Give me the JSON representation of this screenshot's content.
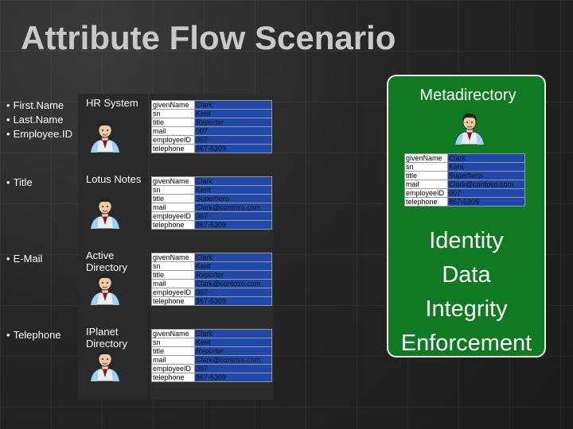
{
  "slide": {
    "title": "Attribute Flow Scenario"
  },
  "rows": [
    {
      "attributes": [
        "First.Name",
        "Last.Name",
        "Employee.ID"
      ],
      "system_name": "HR System",
      "records": [
        [
          "givenName",
          "Clark"
        ],
        [
          "sn",
          "Kent"
        ],
        [
          "title",
          "Reporter"
        ],
        [
          "mail",
          "007"
        ],
        [
          "employeeID",
          "007"
        ],
        [
          "telephone",
          "867-5309"
        ]
      ]
    },
    {
      "attributes": [
        "Title"
      ],
      "system_name": "Lotus Notes",
      "records": [
        [
          "givenName",
          "Clark"
        ],
        [
          "sn",
          "Kent"
        ],
        [
          "title",
          "Superhero"
        ],
        [
          "mail",
          "Clark@contoso.com"
        ],
        [
          "employeeID",
          "007"
        ],
        [
          "telephone",
          "867-5309"
        ]
      ]
    },
    {
      "attributes": [
        "E-Mail"
      ],
      "system_name": "Active Directory",
      "records": [
        [
          "givenName",
          "Clark"
        ],
        [
          "sn",
          "Kent"
        ],
        [
          "title",
          "Reporter"
        ],
        [
          "mail",
          "Clark@contoso.com"
        ],
        [
          "employeeID",
          "007"
        ],
        [
          "telephone",
          "867-5309"
        ]
      ]
    },
    {
      "attributes": [
        "Telephone"
      ],
      "system_name": "IPlanet Directory",
      "records": [
        [
          "givenName",
          "Clark"
        ],
        [
          "sn",
          "Kent"
        ],
        [
          "title",
          "Reporter"
        ],
        [
          "mail",
          "Clark@contoso.com"
        ],
        [
          "employeeID",
          "007"
        ],
        [
          "telephone",
          "867-5309"
        ]
      ]
    }
  ],
  "metadirectory": {
    "title": "Metadirectory",
    "records": [
      [
        "givenName",
        "Clark"
      ],
      [
        "sn",
        "Kent"
      ],
      [
        "title",
        "Superhero"
      ],
      [
        "mail",
        "Clark@contoso.com"
      ],
      [
        "employeeID",
        "007"
      ],
      [
        "telephone",
        "867-5309"
      ]
    ],
    "slogan": [
      "Identity",
      "Data",
      "Integrity",
      "Enforcement"
    ]
  },
  "colors": {
    "metadirectory_fill": "#0f7a22",
    "value_cell": "#1f48a8",
    "title_text": "#c9c9c9"
  },
  "icons": {
    "person": "person-portrait-icon"
  }
}
